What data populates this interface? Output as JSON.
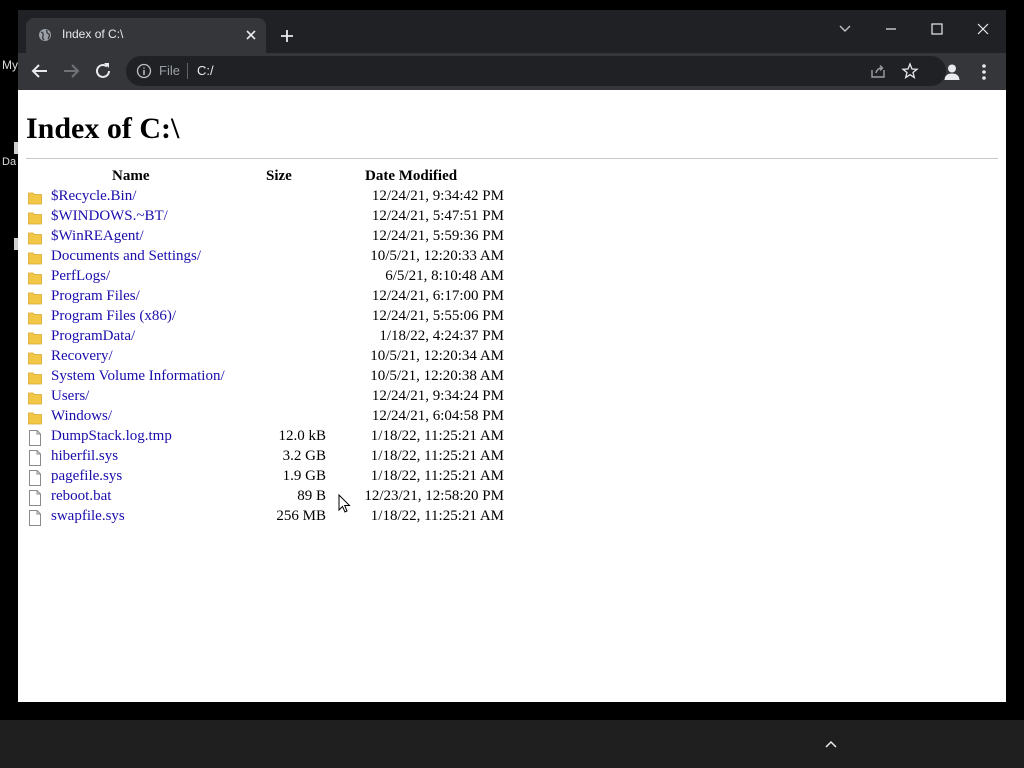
{
  "desktop": {
    "fragment_1": "My",
    "fragment_2": "Da"
  },
  "tab": {
    "title": "Index of C:\\",
    "favicon": "globe-icon"
  },
  "address_bar": {
    "scheme": "File",
    "url": "C:/"
  },
  "page": {
    "title": "Index of C:\\",
    "columns": {
      "name": "Name",
      "size": "Size",
      "date": "Date Modified"
    },
    "entries": [
      {
        "name": "$Recycle.Bin/",
        "size": "",
        "date": "12/24/21, 9:34:42 PM",
        "type": "folder"
      },
      {
        "name": "$WINDOWS.~BT/",
        "size": "",
        "date": "12/24/21, 5:47:51 PM",
        "type": "folder"
      },
      {
        "name": "$WinREAgent/",
        "size": "",
        "date": "12/24/21, 5:59:36 PM",
        "type": "folder"
      },
      {
        "name": "Documents and Settings/",
        "size": "",
        "date": "10/5/21, 12:20:33 AM",
        "type": "folder"
      },
      {
        "name": "PerfLogs/",
        "size": "",
        "date": "6/5/21, 8:10:48 AM",
        "type": "folder"
      },
      {
        "name": "Program Files/",
        "size": "",
        "date": "12/24/21, 6:17:00 PM",
        "type": "folder"
      },
      {
        "name": "Program Files (x86)/",
        "size": "",
        "date": "12/24/21, 5:55:06 PM",
        "type": "folder"
      },
      {
        "name": "ProgramData/",
        "size": "",
        "date": "1/18/22, 4:24:37 PM",
        "type": "folder"
      },
      {
        "name": "Recovery/",
        "size": "",
        "date": "10/5/21, 12:20:34 AM",
        "type": "folder"
      },
      {
        "name": "System Volume Information/",
        "size": "",
        "date": "10/5/21, 12:20:38 AM",
        "type": "folder"
      },
      {
        "name": "Users/",
        "size": "",
        "date": "12/24/21, 9:34:24 PM",
        "type": "folder"
      },
      {
        "name": "Windows/",
        "size": "",
        "date": "12/24/21, 6:04:58 PM",
        "type": "folder"
      },
      {
        "name": "DumpStack.log.tmp",
        "size": "12.0 kB",
        "date": "1/18/22, 11:25:21 AM",
        "type": "file"
      },
      {
        "name": "hiberfil.sys",
        "size": "3.2 GB",
        "date": "1/18/22, 11:25:21 AM",
        "type": "file"
      },
      {
        "name": "pagefile.sys",
        "size": "1.9 GB",
        "date": "1/18/22, 11:25:21 AM",
        "type": "file"
      },
      {
        "name": "reboot.bat",
        "size": "89 B",
        "date": "12/23/21, 12:58:20 PM",
        "type": "file"
      },
      {
        "name": "swapfile.sys",
        "size": "256 MB",
        "date": "1/18/22, 11:25:21 AM",
        "type": "file"
      }
    ]
  },
  "colors": {
    "link": "#1a0dab",
    "folder": "#f3c746",
    "chrome_dark": "#202124",
    "chrome_toolbar": "#35363a",
    "taskbar": "#1f1f1f"
  }
}
